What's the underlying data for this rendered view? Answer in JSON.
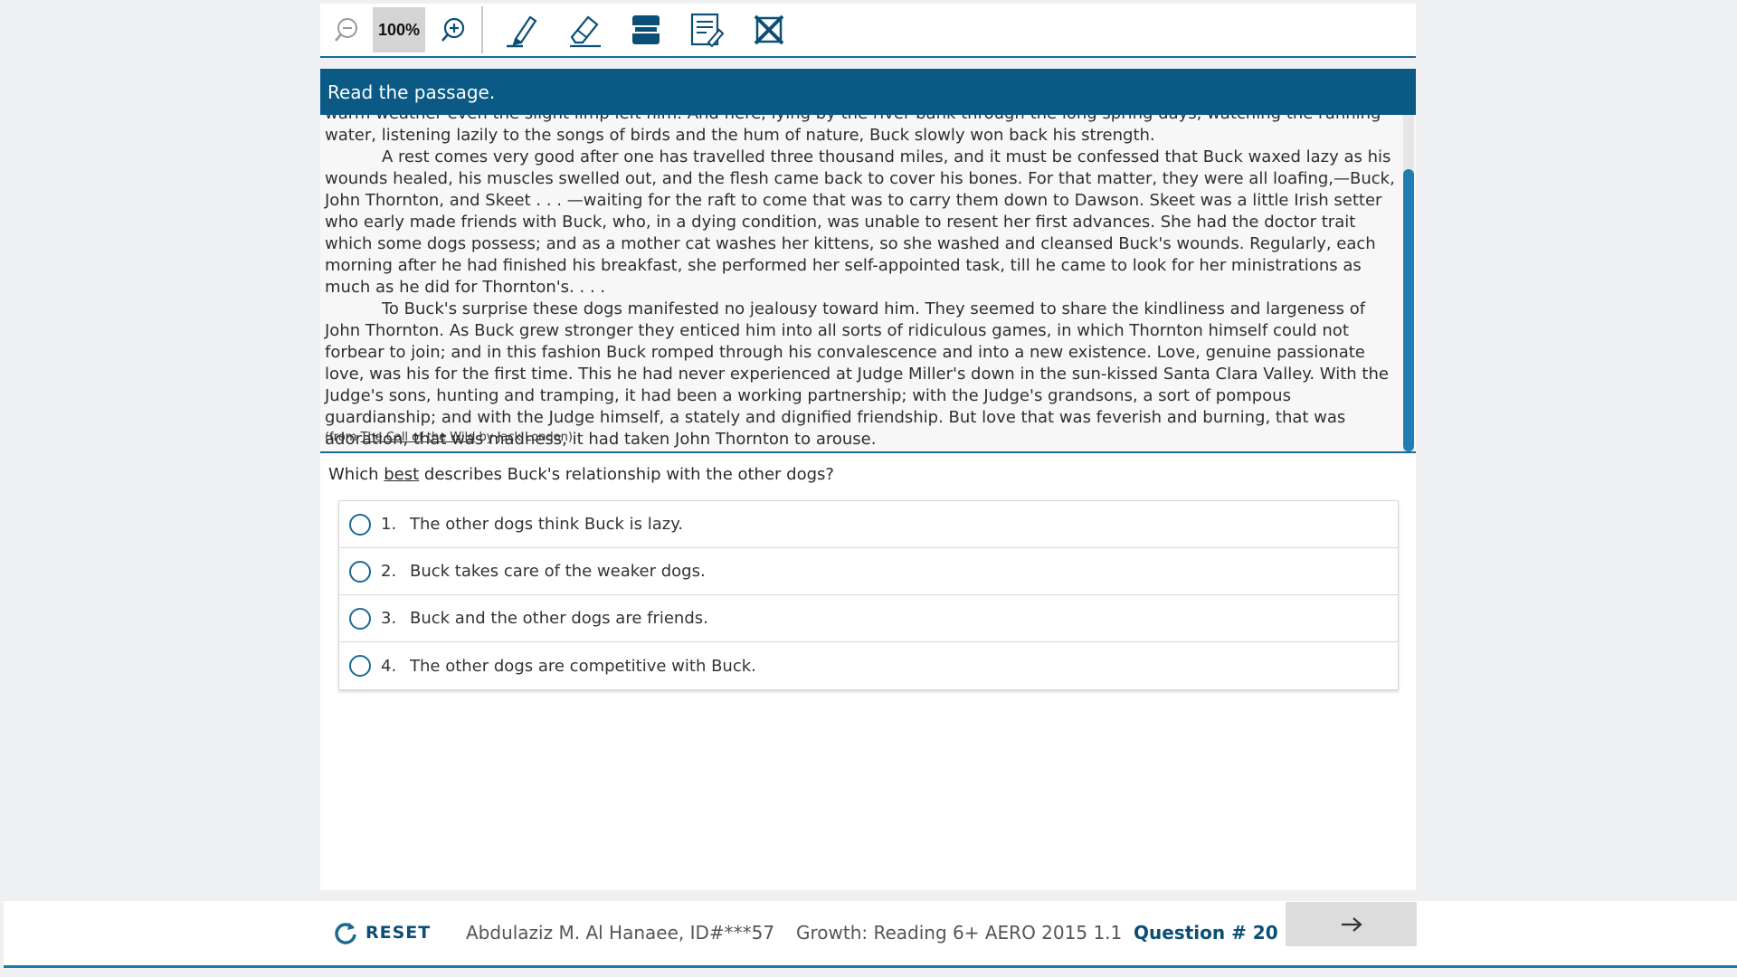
{
  "toolbar": {
    "zoom_level": "100%",
    "zoom_out_icon": "zoom-out-icon",
    "zoom_in_icon": "zoom-in-icon",
    "tools": [
      "highlighter-icon",
      "eraser-icon",
      "line-reader-icon",
      "notepad-icon",
      "answer-eliminator-icon"
    ]
  },
  "passage": {
    "header": "Read the passage.",
    "paragraphs": [
      "warm weather even the slight limp left him. And here, lying by the river bank through the long spring days, watching the running water, listening lazily to the songs of birds and the hum of nature, Buck slowly won back his strength.",
      "A rest comes very good after one has travelled three thousand miles, and it must be confessed that Buck waxed lazy as his wounds healed, his muscles swelled out, and the flesh came back to cover his bones. For that matter, they were all loafing,—Buck, John Thornton, and Skeet . . . —waiting for the raft to come that was to carry them down to Dawson. Skeet was a little Irish setter who early made friends with Buck, who, in a dying condition, was unable to resent her first advances. She had the doctor trait which some dogs possess; and as a mother cat washes her kittens, so she washed and cleansed Buck's wounds. Regularly, each morning after he had finished his breakfast, she performed her self-appointed task, till he came to look for her ministrations as much as he did for Thornton's. . . .",
      "To Buck's surprise these dogs manifested no jealousy toward him. They seemed to share the kindliness and largeness of John Thornton. As Buck grew stronger they enticed him into all sorts of ridiculous games, in which Thornton himself could not forbear to join; and in this fashion Buck romped through his convalescence and into a new existence. Love, genuine passionate love, was his for the first time. This he had never experienced at Judge Miller's down in the sun-kissed Santa Clara Valley. With the Judge's sons, hunting and tramping, it had been a working partnership; with the Judge's grandsons, a sort of pompous guardianship; and with the Judge himself, a stately and dignified friendship. But love that was feverish and burning, that was adoration, that was madness, it had taken John Thornton to arouse."
    ],
    "citation_prefix": "(from ",
    "citation_book": "The Call of the Wild",
    "citation_suffix": " by Jack London)"
  },
  "question": {
    "prefix": "Which ",
    "emphasis": "best",
    "suffix": " describes Buck's relationship with the other dogs?",
    "choices": [
      {
        "num": "1.",
        "text": "The other dogs think Buck is lazy."
      },
      {
        "num": "2.",
        "text": "Buck takes care of the weaker dogs."
      },
      {
        "num": "3.",
        "text": "Buck and the other dogs are friends."
      },
      {
        "num": "4.",
        "text": "The other dogs are competitive with Buck."
      }
    ]
  },
  "footer": {
    "reset_label": "RESET",
    "student": "Abdulaziz M. Al Hanaee, ID#***57",
    "test_name": "Growth: Reading 6+ AERO 2015 1.1",
    "question_number": "Question # 20",
    "next_icon": "arrow-right-icon"
  },
  "colors": {
    "header_bg": "#0b5a85",
    "accent": "#1b6a93",
    "scroll_thumb": "#1f7fb4"
  }
}
